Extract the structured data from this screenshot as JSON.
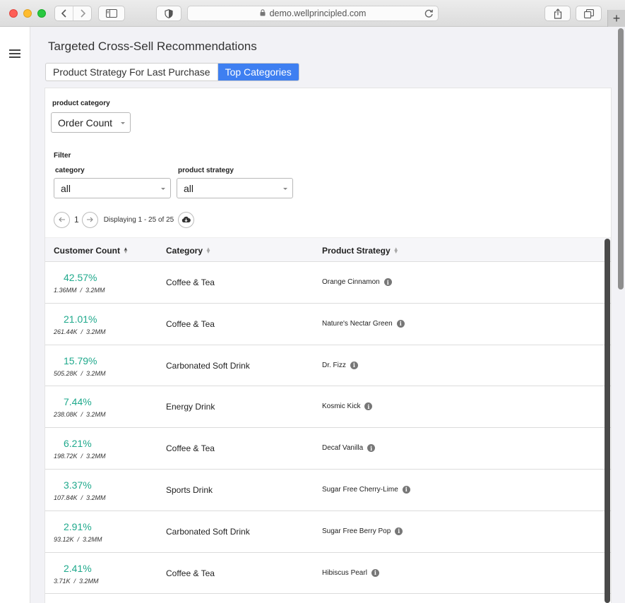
{
  "browser": {
    "url": "demo.wellprincipled.com",
    "new_tab": "+"
  },
  "page": {
    "title": "Targeted Cross-Sell Recommendations",
    "tabs": [
      {
        "label": "Product Strategy For Last Purchase",
        "active": false
      },
      {
        "label": "Top Categories",
        "active": true
      }
    ]
  },
  "controls": {
    "product_category_label": "product category",
    "product_category_value": "Order Count",
    "filter_label": "Filter",
    "category_label": "category",
    "category_value": "all",
    "strategy_label": "product strategy",
    "strategy_value": "all"
  },
  "pager": {
    "page": "1",
    "info": "Displaying 1 - 25 of 25"
  },
  "table": {
    "columns": [
      "Customer Count",
      "Category",
      "Product Strategy"
    ],
    "rows": [
      {
        "pct": "42.57%",
        "count": "1.36MM",
        "total": "3.2MM",
        "category": "Coffee & Tea",
        "strategy": "Orange Cinnamon"
      },
      {
        "pct": "21.01%",
        "count": "261.44K",
        "total": "3.2MM",
        "category": "Coffee & Tea",
        "strategy": "Nature's Nectar Green"
      },
      {
        "pct": "15.79%",
        "count": "505.28K",
        "total": "3.2MM",
        "category": "Carbonated Soft Drink",
        "strategy": "Dr. Fizz"
      },
      {
        "pct": "7.44%",
        "count": "238.08K",
        "total": "3.2MM",
        "category": "Energy Drink",
        "strategy": "Kosmic Kick"
      },
      {
        "pct": "6.21%",
        "count": "198.72K",
        "total": "3.2MM",
        "category": "Coffee & Tea",
        "strategy": "Decaf Vanilla"
      },
      {
        "pct": "3.37%",
        "count": "107.84K",
        "total": "3.2MM",
        "category": "Sports Drink",
        "strategy": "Sugar Free Cherry-Lime"
      },
      {
        "pct": "2.91%",
        "count": "93.12K",
        "total": "3.2MM",
        "category": "Carbonated Soft Drink",
        "strategy": "Sugar Free Berry Pop"
      },
      {
        "pct": "2.41%",
        "count": "3.71K",
        "total": "3.2MM",
        "category": "Coffee & Tea",
        "strategy": "Hibiscus Pearl"
      }
    ]
  },
  "colors": {
    "accent": "#3e7ff1",
    "percent": "#1fa98c"
  }
}
